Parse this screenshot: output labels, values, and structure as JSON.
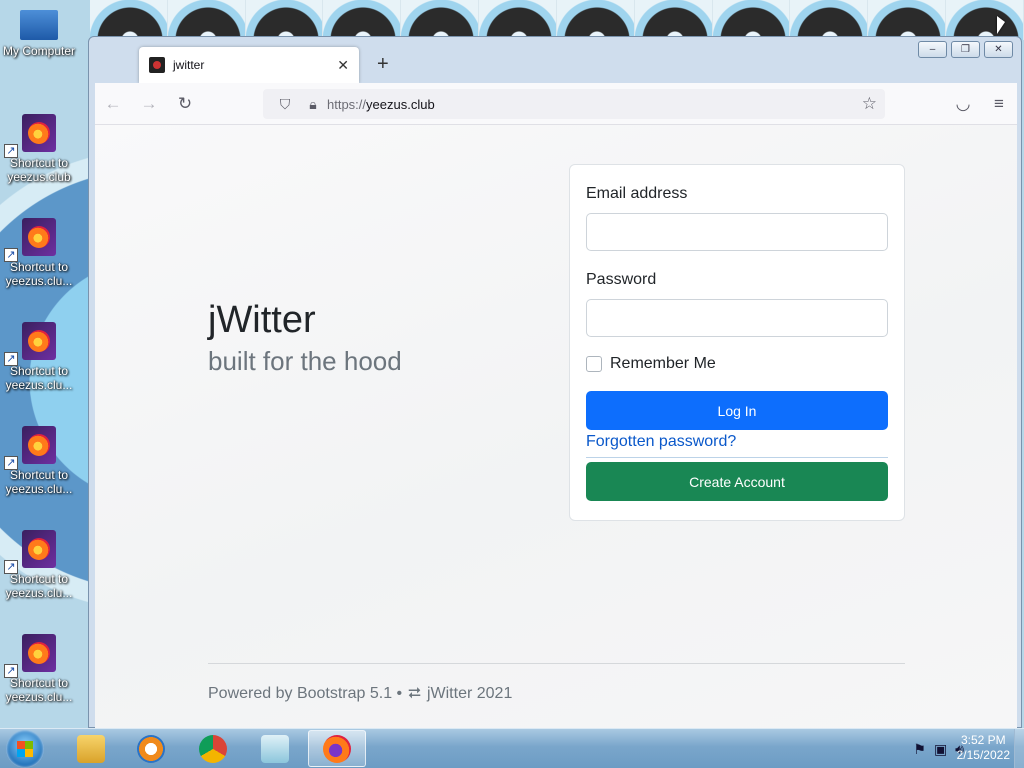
{
  "desktop": {
    "icons": [
      {
        "label": "My Computer"
      },
      {
        "label": "Shortcut to yeezus.club"
      },
      {
        "label": "Shortcut to yeezus.clu..."
      },
      {
        "label": "Shortcut to yeezus.clu..."
      },
      {
        "label": "Shortcut to yeezus.clu..."
      },
      {
        "label": "Shortcut to yeezus.clu..."
      },
      {
        "label": "Shortcut to yeezus.clu..."
      }
    ]
  },
  "browser": {
    "tab_title": "jwitter",
    "tab_close": "✕",
    "new_tab": "+",
    "url_prefix": "https://",
    "url_host": "yeezus.club",
    "window_controls": {
      "minimize": "–",
      "restore": "❐",
      "close": "✕"
    }
  },
  "page": {
    "brand_title": "jWitter",
    "brand_tagline": "built for the hood",
    "login": {
      "email_label": "Email address",
      "email_value": "",
      "password_label": "Password",
      "password_value": "",
      "remember_label": "Remember Me",
      "remember_checked": false,
      "login_button": "Log In",
      "forgot_link": "Forgotten password?",
      "create_button": "Create Account"
    },
    "footer": {
      "powered_by": "Powered by Bootstrap 5.1 •",
      "brand_year": "jWitter 2021",
      "icon": "retweet-icon"
    }
  },
  "taskbar": {
    "clock_time": "3:52 PM",
    "clock_date": "2/15/2022",
    "buttons": [
      "file-explorer",
      "media-player",
      "chrome",
      "notepad",
      "firefox"
    ],
    "active": "firefox"
  },
  "colors": {
    "primary_button": "#0d6efd",
    "success_button": "#198754",
    "link": "#0a58ca"
  }
}
